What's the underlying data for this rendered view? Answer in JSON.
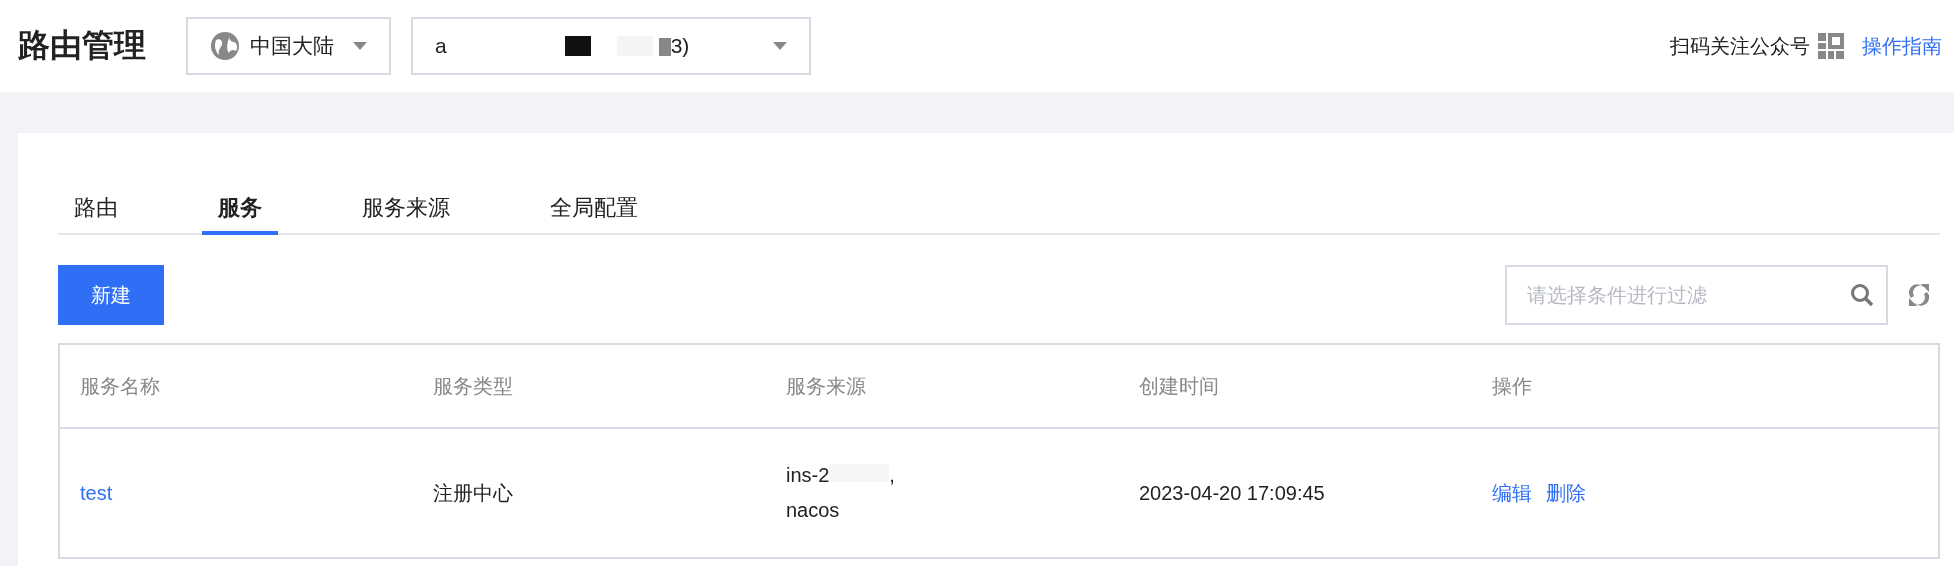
{
  "header": {
    "title": "路由管理",
    "region_select": {
      "value": "中国大陆"
    },
    "gateway_select": {
      "value_start": "a",
      "value_end": "3)"
    },
    "follow_text": "扫码关注公众号",
    "guide_link": "操作指南"
  },
  "tabs": [
    {
      "label": "路由",
      "selected": false
    },
    {
      "label": "服务",
      "selected": true
    },
    {
      "label": "服务来源",
      "selected": false
    },
    {
      "label": "全局配置",
      "selected": false
    }
  ],
  "toolbar": {
    "create_button": "新建",
    "filter": {
      "placeholder": "请选择条件进行过滤"
    }
  },
  "table": {
    "columns": [
      "服务名称",
      "服务类型",
      "服务来源",
      "创建时间",
      "操作"
    ],
    "rows": [
      {
        "name": "test",
        "type": "注册中心",
        "source_start": "ins-2",
        "source_end": ",",
        "source_kind": "nacos",
        "created": "2023-04-20 17:09:45",
        "actions": [
          "编辑",
          "删除"
        ]
      }
    ]
  }
}
